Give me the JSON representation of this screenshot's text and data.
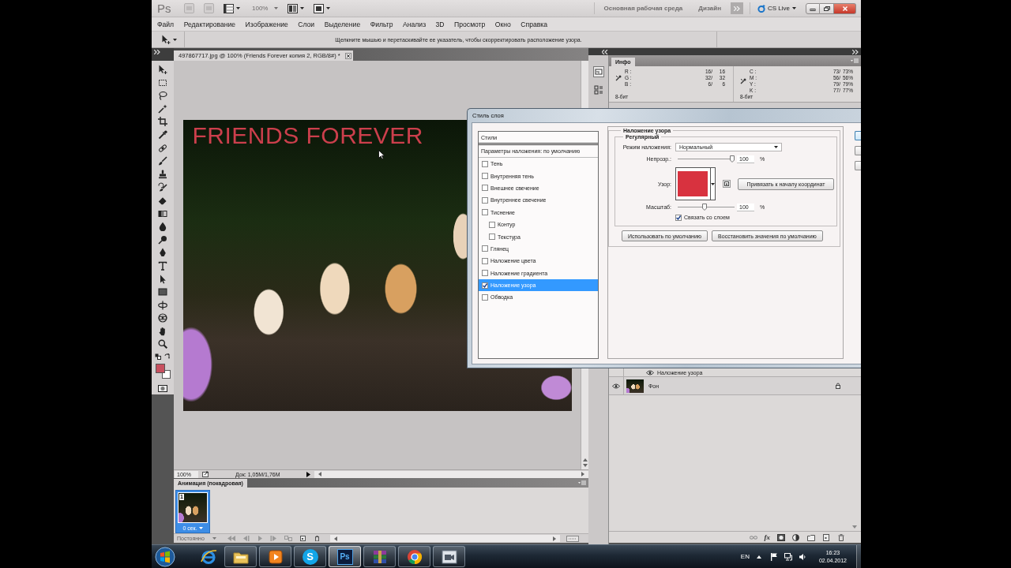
{
  "app_bar": {
    "logo": "Ps",
    "zoom": {
      "value": "100%",
      "disabled": true
    },
    "workspaces": [
      "Основная рабочая среда",
      "Дизайн"
    ],
    "cs_live": "CS Live"
  },
  "menu": [
    "Файл",
    "Редактирование",
    "Изображение",
    "Слои",
    "Выделение",
    "Фильтр",
    "Анализ",
    "3D",
    "Просмотр",
    "Окно",
    "Справка"
  ],
  "options_bar": {
    "hint": "Щелкните мышью и перетаскивайте ее указатель, чтобы скорректировать расположение узора."
  },
  "document": {
    "tab": "497867717.jpg @ 100% (Friends Forever копия 2, RGB/8#) *",
    "canvas_text": "FRIENDS FOREVER",
    "zoom": "100%",
    "doc_info": "Док: 1,05М/1,76М"
  },
  "animation": {
    "tab": "Анимация (покадровая)",
    "frames": [
      {
        "number": "1",
        "delay": "0 сек.",
        "selected": true
      }
    ],
    "loop": "Постоянно"
  },
  "info": {
    "tab": "Инфо",
    "groups": [
      {
        "rows": [
          {
            "label": "R :",
            "values": [
              "16/",
              "16"
            ]
          },
          {
            "label": "G :",
            "values": [
              "32/",
              "32"
            ]
          },
          {
            "label": "B :",
            "values": [
              "6/",
              "6"
            ]
          }
        ],
        "depth": "8-бит"
      },
      {
        "rows": [
          {
            "label": "C :",
            "values": [
              "73/",
              "73%"
            ]
          },
          {
            "label": "M :",
            "values": [
              "56/",
              "56%"
            ]
          },
          {
            "label": "Y :",
            "values": [
              "79/",
              "79%"
            ]
          },
          {
            "label": "K :",
            "values": [
              "77/",
              "77%"
            ]
          }
        ],
        "depth": "8-бит"
      }
    ]
  },
  "layer_style": {
    "title": "Стиль слоя",
    "styles_header": "Стили",
    "blending": {
      "label": "Параметры наложения: по умолчанию",
      "selected": false
    },
    "effects": [
      {
        "label": "Тень",
        "checked": false,
        "selected": false
      },
      {
        "label": "Внутренняя тень",
        "checked": false,
        "selected": false
      },
      {
        "label": "Внешнее свечение",
        "checked": false,
        "selected": false
      },
      {
        "label": "Внутреннее свечение",
        "checked": false,
        "selected": false
      },
      {
        "label": "Тиснение",
        "checked": false,
        "selected": false,
        "children": [
          {
            "label": "Контур",
            "checked": false,
            "selected": false
          },
          {
            "label": "Текстура",
            "checked": false,
            "selected": false
          }
        ]
      },
      {
        "label": "Глянец",
        "checked": false,
        "selected": false
      },
      {
        "label": "Наложение цвета",
        "checked": false,
        "selected": false
      },
      {
        "label": "Наложение градиента",
        "checked": false,
        "selected": false
      },
      {
        "label": "Наложение узора",
        "checked": true,
        "selected": true
      },
      {
        "label": "Обводка",
        "checked": false,
        "selected": false
      }
    ],
    "pattern_overlay": {
      "title": "Наложение узора",
      "group": "Регулярный",
      "blend_mode": {
        "label": "Режим наложения:",
        "value": "Нормальный"
      },
      "opacity": {
        "label": "Непрозр.:",
        "level": 1,
        "value": "100",
        "unit": "%"
      },
      "pattern": {
        "label": "Узор:"
      },
      "snap_button": "Привязать к началу координат",
      "scale": {
        "label": "Масштаб:",
        "level": 0.47,
        "value": "100",
        "unit": "%"
      },
      "link": {
        "label": "Связать со слоем",
        "checked": true
      },
      "buttons": [
        "Использовать по умолчанию",
        "Восстановить значения по умолчанию"
      ]
    }
  },
  "layers": {
    "rows": [
      {
        "kind": "effect",
        "name": "Наложение узора",
        "visible": true,
        "locked": false
      },
      {
        "kind": "layer",
        "name": "Фон",
        "visible": true,
        "locked": true
      }
    ],
    "fx_button": "fx"
  },
  "taskbar": {
    "apps": [
      {
        "kind": "ie",
        "running": false,
        "selected": false
      },
      {
        "kind": "folder",
        "running": true,
        "selected": false
      },
      {
        "kind": "media",
        "running": true,
        "selected": false
      },
      {
        "kind": "skype",
        "label": "S",
        "running": true,
        "selected": false
      },
      {
        "kind": "photoshop",
        "label": "Ps",
        "running": true,
        "selected": true
      },
      {
        "kind": "archive",
        "running": true,
        "selected": false
      },
      {
        "kind": "chrome",
        "running": true,
        "selected": false
      },
      {
        "kind": "video",
        "running": true,
        "selected": false
      }
    ],
    "language": "EN",
    "time": "16:23",
    "date": "02.04.2012"
  }
}
